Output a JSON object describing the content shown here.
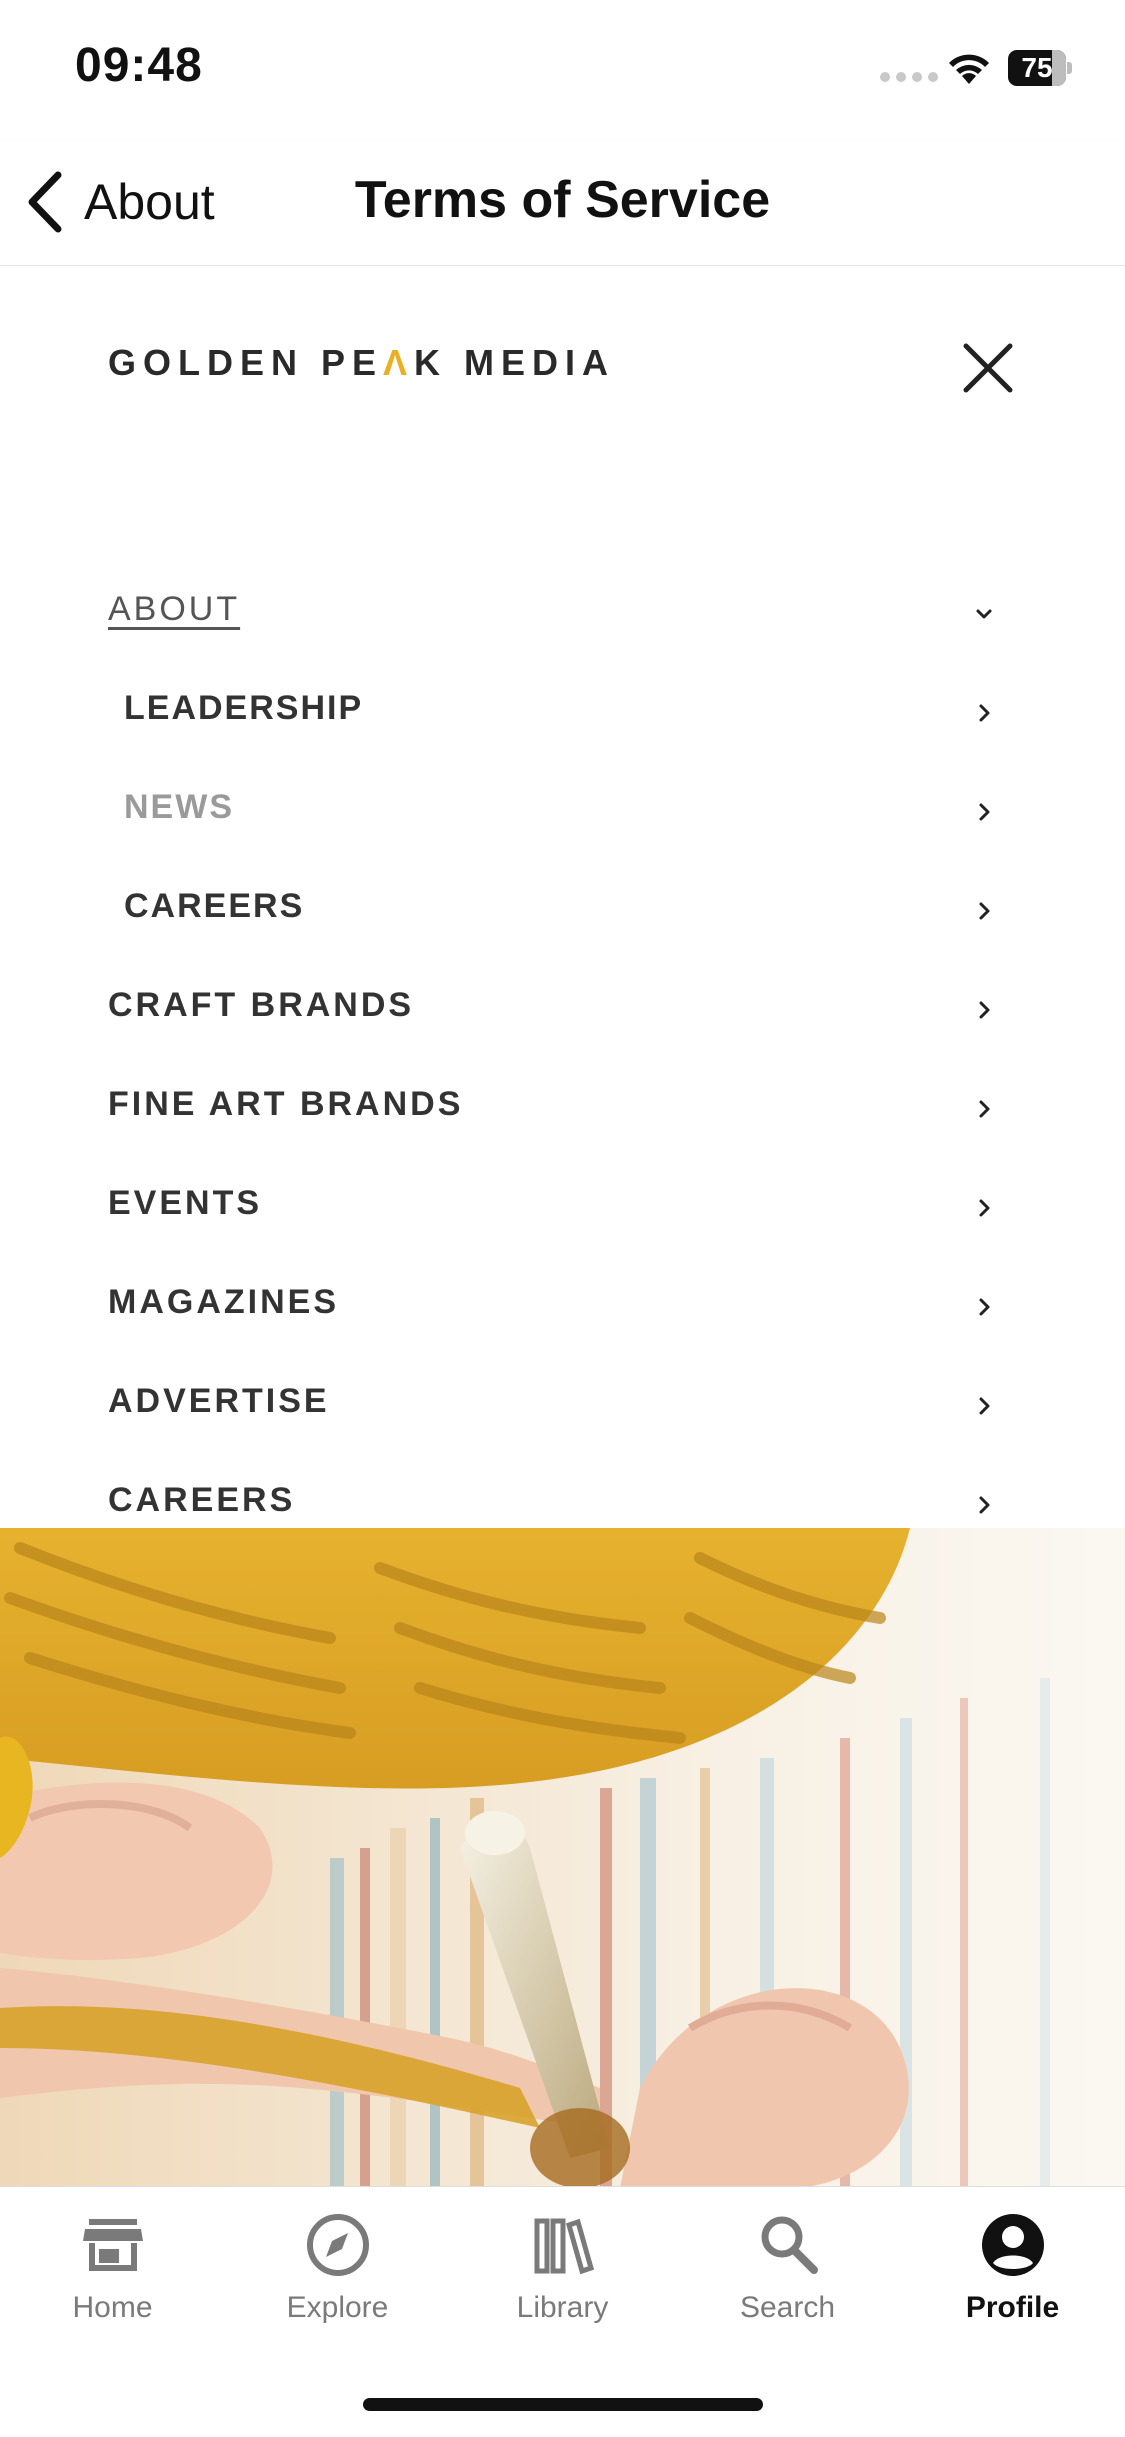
{
  "status_bar": {
    "time": "09:48",
    "battery": "75"
  },
  "nav": {
    "back_label": "About",
    "title": "Terms of Service"
  },
  "site": {
    "logo_part1": "GOLDEN PE",
    "logo_peak": "Λ",
    "logo_part2": "K MEDIA",
    "menu": [
      {
        "label": "ABOUT",
        "level": "top",
        "state": "active",
        "chevron": "chevron-down-icon"
      },
      {
        "label": "LEADERSHIP",
        "level": "sub",
        "state": "normal",
        "chevron": "chevron-right-icon"
      },
      {
        "label": "NEWS",
        "level": "sub",
        "state": "dim",
        "chevron": "chevron-right-icon"
      },
      {
        "label": "CAREERS",
        "level": "sub",
        "state": "normal",
        "chevron": "chevron-right-icon"
      },
      {
        "label": "CRAFT BRANDS",
        "level": "top",
        "state": "normal",
        "chevron": "chevron-right-icon"
      },
      {
        "label": "FINE ART BRANDS",
        "level": "top",
        "state": "normal",
        "chevron": "chevron-right-icon"
      },
      {
        "label": "EVENTS",
        "level": "top",
        "state": "normal",
        "chevron": "chevron-right-icon"
      },
      {
        "label": "MAGAZINES",
        "level": "top",
        "state": "normal",
        "chevron": "chevron-right-icon"
      },
      {
        "label": "ADVERTISE",
        "level": "top",
        "state": "normal",
        "chevron": "chevron-right-icon"
      },
      {
        "label": "CAREERS",
        "level": "top",
        "state": "normal",
        "chevron": "chevron-right-icon"
      }
    ],
    "accent_color": "#e9b021"
  },
  "tab_bar": {
    "tabs": [
      {
        "label": "Home",
        "icon": "storefront-icon"
      },
      {
        "label": "Explore",
        "icon": "compass-icon"
      },
      {
        "label": "Library",
        "icon": "books-icon"
      },
      {
        "label": "Search",
        "icon": "search-icon"
      },
      {
        "label": "Profile",
        "icon": "profile-icon"
      }
    ],
    "active": "Profile"
  }
}
